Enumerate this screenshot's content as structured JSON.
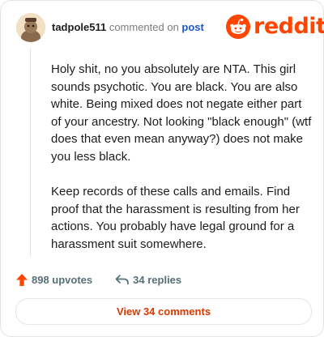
{
  "comment": {
    "username": "tadpole511",
    "action_text": " commented on ",
    "post_link": "post",
    "paragraphs": [
      "Holy shit, no you absolutely are NTA. This girl sounds psychotic. You are black. You are also white. Being mixed does not negate either part of your ancestry. Not looking \"black enough\" (wtf does that even mean anyway?) does not make you less black.",
      "Keep records of these calls and emails. Find proof that the harassment is resulting from her actions. You probably have legal ground for a harassment suit somewhere."
    ]
  },
  "brand": {
    "name": "reddit",
    "icon": "reddit-snoo-icon",
    "color": "#ff4500"
  },
  "stats": {
    "upvotes": "898 upvotes",
    "replies": "34 replies"
  },
  "cta": {
    "view_comments": "View 34 comments"
  },
  "colors": {
    "accent": "#ff4500",
    "button_text": "#d93a00",
    "link": "#1a57c9"
  }
}
